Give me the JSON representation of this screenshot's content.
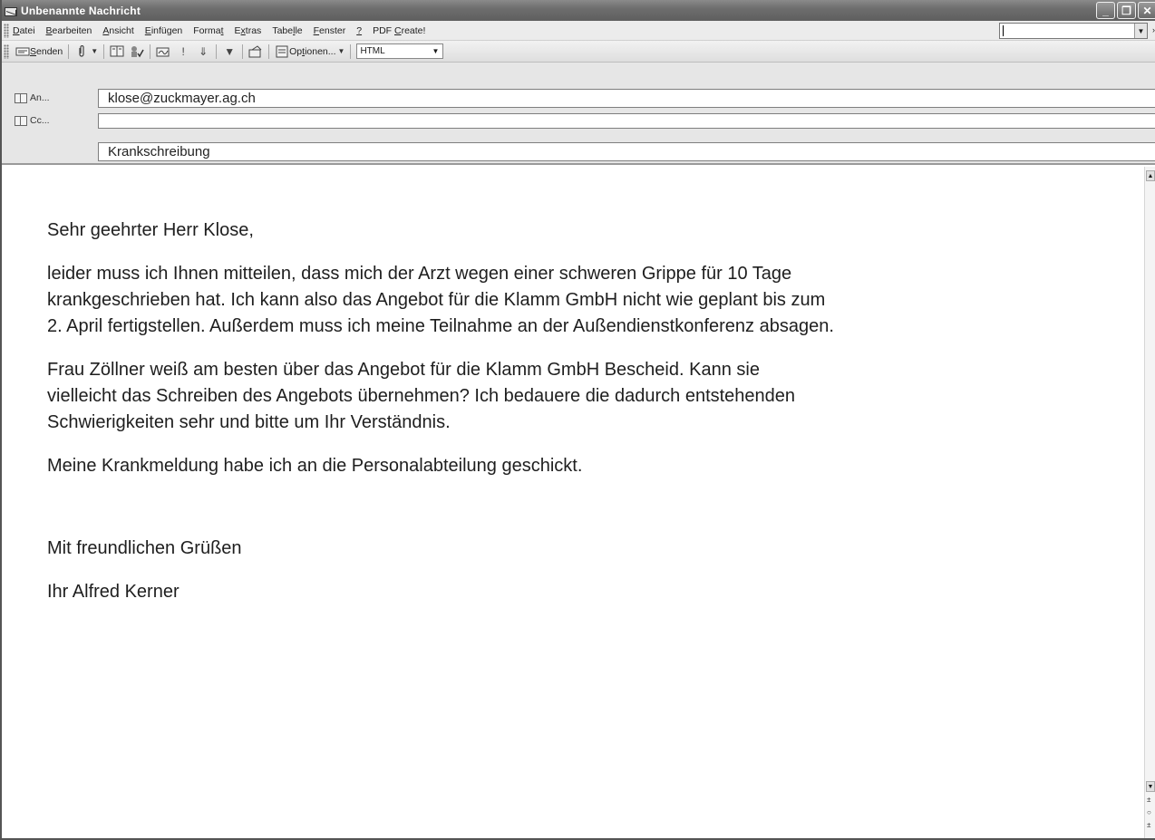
{
  "window": {
    "title": "Unbenannte Nachricht",
    "controls": {
      "minimize": "_",
      "restore": "❐",
      "close": "✕"
    }
  },
  "menu": {
    "items": [
      {
        "pre": "",
        "key": "D",
        "post": "atei"
      },
      {
        "pre": "",
        "key": "B",
        "post": "earbeiten"
      },
      {
        "pre": "",
        "key": "A",
        "post": "nsicht"
      },
      {
        "pre": "",
        "key": "E",
        "post": "infügen"
      },
      {
        "pre": "Forma",
        "key": "t",
        "post": ""
      },
      {
        "pre": "E",
        "key": "x",
        "post": "tras"
      },
      {
        "pre": "Tabe",
        "key": "l",
        "post": "le"
      },
      {
        "pre": "",
        "key": "F",
        "post": "enster"
      },
      {
        "pre": "",
        "key": "?",
        "post": ""
      },
      {
        "pre": "PDF ",
        "key": "C",
        "post": "reate!"
      }
    ],
    "question_box_value": ""
  },
  "toolbar": {
    "send": {
      "key": "S",
      "rest": "enden"
    },
    "options": {
      "pre": "Op",
      "key": "t",
      "post": "ionen..."
    },
    "format": "HTML",
    "icons": [
      "send-icon",
      "paperclip-icon",
      "address-book-icon",
      "check-names-icon",
      "signature-icon",
      "high-importance-icon",
      "low-importance-icon",
      "flag-icon",
      "permission-icon",
      "options-icon"
    ]
  },
  "header": {
    "to_label": "An...",
    "to_value": "klose@zuckmayer.ag.ch",
    "cc_label": "Cc...",
    "cc_value": "",
    "subject_value": "Krankschreibung"
  },
  "body": {
    "greeting": "Sehr geehrter Herr Klose,",
    "p1_line1": "leider muss ich Ihnen mitteilen, dass mich der Arzt wegen einer schweren Grippe für 10 Tage",
    "p1_line2": "krankgeschrieben hat. Ich kann also das Angebot für die Klamm GmbH nicht wie geplant bis zum",
    "p1_line3": "2. April fertigstellen. Außerdem muss ich meine Teilnahme an der Außendienstkonferenz absagen.",
    "p2_line1": "Frau Zöllner weiß am besten über das Angebot für die Klamm GmbH Bescheid. Kann sie",
    "p2_line2": "vielleicht das Schreiben des Angebots übernehmen? Ich bedauere die dadurch entstehenden",
    "p2_line3": "Schwierigkeiten sehr und bitte um Ihr Verständnis.",
    "p3": "Meine Krankmeldung habe ich an die Personalabteilung geschickt.",
    "closing": "Mit freundlichen Grüßen",
    "signature": "Ihr Alfred Kerner"
  }
}
